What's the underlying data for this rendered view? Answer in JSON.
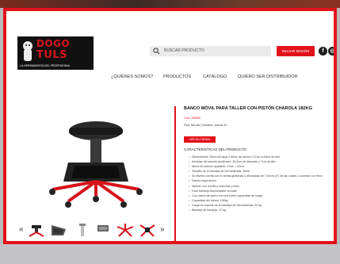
{
  "header": {
    "logo": {
      "line1": "DOGO",
      "line2": "TULS",
      "tagline": "LA HERRAMIENTA DEL PROFESIONAL"
    },
    "search": {
      "placeholder": "BUSCAR PRODUCTO",
      "icon": "search-icon"
    },
    "login_label": "INICIAR SESIÓN",
    "social": [
      {
        "icon": "facebook-icon",
        "glyph": "f"
      },
      {
        "icon": "instagram-icon",
        "glyph": "◎"
      }
    ]
  },
  "nav": {
    "items": [
      "¿QUIÉNES SOMOS?",
      "PRODUCTOS",
      "CATÁLOGO",
      "QUIERO SER DISTRIBUIDOR"
    ]
  },
  "product": {
    "title": "BANCO MÓVIL PARA TALLER CON PISTÓN CHAROLA 182KG",
    "code": "Cod. 80265",
    "meta": "Pza. tienda | Modelo: forma. B",
    "price_button": "VER EN TIENDA",
    "features_title": "CARACTERISTICAS DEL PRODUCTO",
    "features": [
      "Dimensiones: 50cm de largo x 60cm de ancho x 47cm a 63cm de alto",
      "Medidas del asiento acolchado: 35.5cm de diámetro x 7cm de alto",
      "Altura de asiento ajustable: 47cm – 63cm",
      "Tamaño de la bandeja de herramientas: 45cm",
      "Su diseño cuenta con 5 ruedas giratorias y abrazadas de 7.62cm (3\") de las cuales 2 cuentan con freno",
      "Diseño ergonómico",
      "Asiento con tornillo y manchas y sello",
      "Gran bandeja desmontable incluida",
      "Con marco de acero con una fuerte capacidad de carga",
      "Capacidad del banco: 180kg",
      "Carga de soporte de la bandeja de herramientas: 40 kg",
      "Bandeja de bandeja: 10 kg"
    ]
  },
  "colors": {
    "accent": "#e2121b",
    "dark": "#1c1c1c"
  },
  "gallery": {
    "prev_arrow": "«",
    "next_arrow": "»",
    "thumbnails": [
      "stool-front",
      "stool-tray",
      "stool-piston",
      "stool-base",
      "stool-wheels",
      "stool-seat"
    ]
  }
}
